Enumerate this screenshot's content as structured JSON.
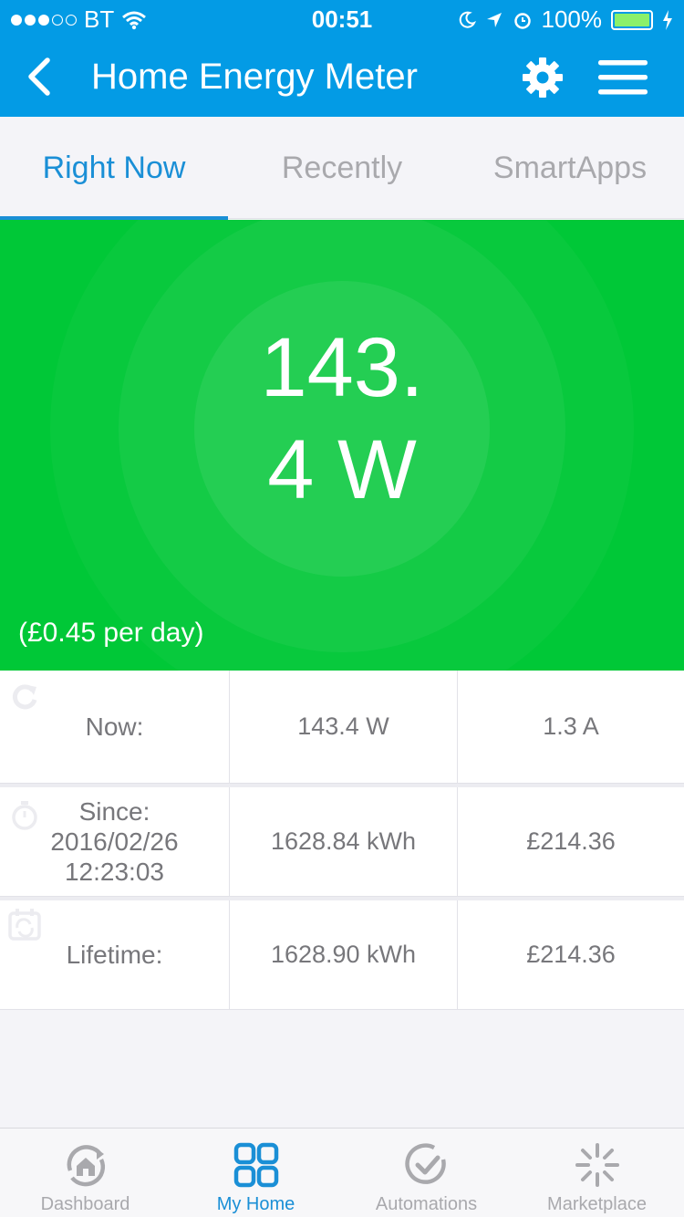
{
  "status_bar": {
    "carrier": "BT",
    "time": "00:51",
    "battery": "100%",
    "signal_icon": "signal-dots-icon",
    "wifi_icon": "wifi-icon"
  },
  "nav": {
    "title": "Home Energy Meter",
    "back_icon": "chevron-left-icon",
    "settings_icon": "gear-icon",
    "menu_icon": "hamburger-menu-icon"
  },
  "tabs": [
    {
      "label": "Right Now",
      "active": true
    },
    {
      "label": "Recently",
      "active": false
    },
    {
      "label": "SmartApps",
      "active": false
    }
  ],
  "hero": {
    "power_line1": "143.",
    "power_line2": "4 W",
    "cost": "(£0.45 per day)",
    "color": "#00c837"
  },
  "rows": [
    {
      "icon": "refresh-icon",
      "label": "Now:",
      "value": "143.4 W",
      "extra": "1.3 A"
    },
    {
      "icon": "stopwatch-icon",
      "label_line1": "Since:",
      "label_line2": "2016/02/26",
      "label_line3": "12:23:03",
      "value": "1628.84 kWh",
      "extra": "£214.36"
    },
    {
      "icon": "calendar-repeat-icon",
      "label": "Lifetime:",
      "value": "1628.90 kWh",
      "extra": "£214.36"
    }
  ],
  "bottom_tabs": [
    {
      "label": "Dashboard",
      "icon": "dashboard-home-icon",
      "active": false
    },
    {
      "label": "My Home",
      "icon": "grid-icon",
      "active": true
    },
    {
      "label": "Automations",
      "icon": "check-circle-icon",
      "active": false
    },
    {
      "label": "Marketplace",
      "icon": "sparkle-icon",
      "active": false
    }
  ],
  "colors": {
    "primary": "#039be5",
    "accent": "#1a8fd6",
    "inactive": "#a9a9ad"
  }
}
